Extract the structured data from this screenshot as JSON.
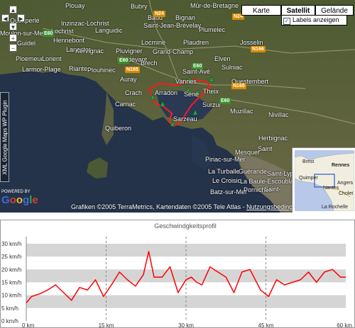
{
  "map": {
    "map_types": [
      "Karte",
      "Satellit",
      "Gelände"
    ],
    "active_map_type": "Satellit",
    "labels_checkbox": {
      "label": "Labels anzeigen",
      "checked": true
    },
    "plugin_label": "XML Google Maps WP Plugin",
    "powered_by": "POWERED BY",
    "google_logo": "Google",
    "copyright": "Grafiken ©2005 TerraMetrics, Kartendaten ©2005 Tele Atlas - ",
    "terms_link": "Nutzungsbedingungen",
    "places": [
      "Quimperlé",
      "Plouay",
      "Bubry",
      "Baud",
      "Mûr-de-Bretagne",
      "Inzinzac-Lochrist",
      "Languidic",
      "Bignan",
      "Saint-Jean-Brévelay",
      "Plumelec",
      "Moulon-sur-Mer",
      "Lochrist",
      "Hennebont",
      "Locminé",
      "Plaudren",
      "Josselin",
      "Guidel",
      "Lanester",
      "Kervignac",
      "Pluvigner",
      "Grand-Champ",
      "Elven",
      "Ploemeur",
      "Lorient",
      "Riantec",
      "Landévant",
      "Larmor-Plage",
      "Plouhinec",
      "Brech",
      "Saint-Avé",
      "Sulniac",
      "Questembert",
      "Auray",
      "Vannes",
      "Crach",
      "Séné",
      "Theix",
      "Arradon",
      "Carnac",
      "Surzur",
      "Sarzeau",
      "Muzillac",
      "Nivillac",
      "Quiberon",
      "Herbignac",
      "Saint",
      "Mesquer",
      "Piriac-sur-Mer",
      "Guérande",
      "La Turballe",
      "Saint-Lyphard",
      "Le Croisic",
      "Batz-sur-Mer",
      "Pornichet",
      "La Baule-Escoublac",
      "Saint-"
    ],
    "roads": [
      "N24",
      "N24",
      "E60",
      "E60",
      "N165",
      "E60",
      "N166",
      "N165",
      "E60"
    ],
    "overview": {
      "labels": [
        "Brest",
        "Rennes",
        "Quimper",
        "Nantes",
        "Angers",
        "Cholet",
        "La Rochelle"
      ]
    }
  },
  "chart_data": {
    "type": "line",
    "title": "Geschwindgkeitsprofil",
    "xlabel": "",
    "ylabel": "",
    "x_ticks": [
      "0 km",
      "15 km",
      "30 km",
      "45 km",
      "60 km"
    ],
    "y_ticks": [
      "0 km/h",
      "5 km/h",
      "10 km/h",
      "15 km/h",
      "20 km/h",
      "25 km/h",
      "30 km/h"
    ],
    "xlim": [
      0,
      60
    ],
    "ylim": [
      0,
      30
    ],
    "grid": true,
    "series": [
      {
        "color": "#ff0000",
        "x": [
          0,
          1,
          2.5,
          4,
          5.5,
          7,
          8.5,
          10,
          11.5,
          13,
          14.5,
          16,
          17.5,
          19,
          20.5,
          22,
          23,
          24,
          25.5,
          27,
          28.5,
          30,
          31,
          32,
          33,
          34.5,
          36,
          37.5,
          39,
          40.5,
          42,
          43,
          44,
          45.5,
          47,
          48.5,
          50,
          51.5,
          53,
          54.5,
          56,
          57.5,
          59,
          60
        ],
        "y": [
          7,
          9.5,
          10.5,
          12,
          14,
          11,
          8,
          13,
          12,
          16,
          9.5,
          14,
          19,
          16,
          13.5,
          18,
          27,
          17,
          17,
          21,
          11,
          16,
          17,
          15,
          14,
          21,
          19,
          17,
          11,
          19,
          20,
          16,
          12,
          9.5,
          16,
          14,
          15,
          16,
          19,
          15,
          19,
          20,
          17,
          17
        ]
      }
    ]
  }
}
